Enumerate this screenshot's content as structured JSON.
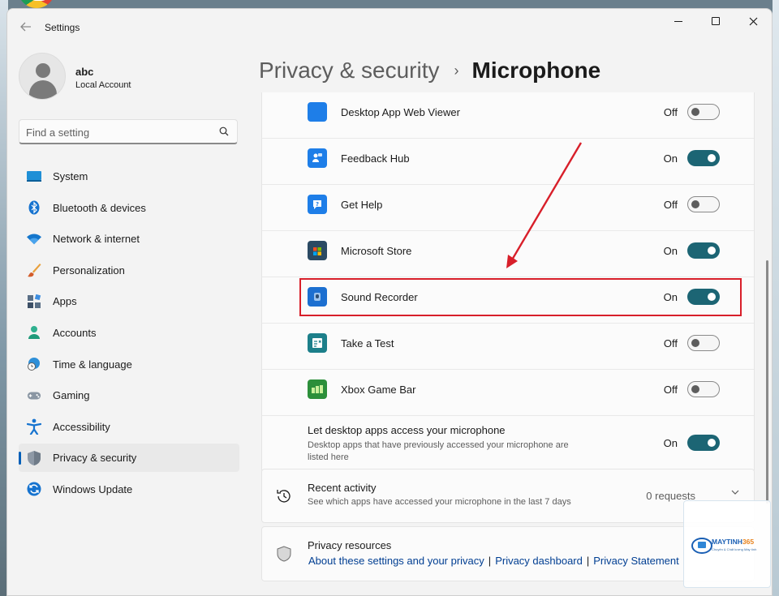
{
  "window": {
    "app_title": "Settings",
    "back_icon": "back-arrow-icon",
    "controls": [
      "minimize-icon",
      "maximize-icon",
      "close-icon"
    ]
  },
  "profile": {
    "name": "abc",
    "account_type": "Local Account"
  },
  "search": {
    "placeholder": "Find a setting"
  },
  "nav": {
    "items": [
      {
        "label": "System",
        "icon": "system-icon"
      },
      {
        "label": "Bluetooth & devices",
        "icon": "bluetooth-icon"
      },
      {
        "label": "Network & internet",
        "icon": "wifi-icon"
      },
      {
        "label": "Personalization",
        "icon": "brush-icon"
      },
      {
        "label": "Apps",
        "icon": "apps-icon"
      },
      {
        "label": "Accounts",
        "icon": "accounts-icon"
      },
      {
        "label": "Time & language",
        "icon": "globe-clock-icon"
      },
      {
        "label": "Gaming",
        "icon": "gamepad-icon"
      },
      {
        "label": "Accessibility",
        "icon": "accessibility-icon"
      },
      {
        "label": "Privacy & security",
        "icon": "shield-icon",
        "active": true
      },
      {
        "label": "Windows Update",
        "icon": "update-icon"
      }
    ]
  },
  "header": {
    "parent": "Privacy & security",
    "separator": "›",
    "current": "Microphone"
  },
  "apps": [
    {
      "name": "Desktop App Web Viewer",
      "state": "Off",
      "icon": "web-viewer-icon",
      "color": "#1e7ee8"
    },
    {
      "name": "Feedback Hub",
      "state": "On",
      "icon": "feedback-hub-icon",
      "color": "#1e7ee8"
    },
    {
      "name": "Get Help",
      "state": "Off",
      "icon": "get-help-icon",
      "color": "#1e7ee8"
    },
    {
      "name": "Microsoft Store",
      "state": "On",
      "icon": "store-icon",
      "color": "#2b4a63"
    },
    {
      "name": "Sound Recorder",
      "state": "On",
      "icon": "sound-recorder-icon",
      "color": "#1c6fd0",
      "highlighted": true
    },
    {
      "name": "Take a Test",
      "state": "Off",
      "icon": "take-a-test-icon",
      "color": "#1c7f8a"
    },
    {
      "name": "Xbox Game Bar",
      "state": "Off",
      "icon": "xbox-game-bar-icon",
      "color": "#2c8f3a"
    }
  ],
  "desktop_access": {
    "title": "Let desktop apps access your microphone",
    "description": "Desktop apps that have previously accessed your microphone are listed here",
    "state": "On"
  },
  "recent_activity": {
    "title": "Recent activity",
    "description": "See which apps have accessed your microphone in the last 7 days",
    "count": "0 requests",
    "icon": "history-icon"
  },
  "privacy_resources": {
    "title": "Privacy resources",
    "links": [
      "About these settings and your privacy",
      "Privacy dashboard",
      "Privacy Statement"
    ],
    "separator": "|",
    "icon": "shield-outline-icon"
  },
  "watermark": {
    "brand": "MAYTINH365",
    "tagline": "Chuyên & Chất lượng Máy tính"
  },
  "colors": {
    "toggle_on": "#1c6574",
    "accent": "#005fb8",
    "highlight_box": "#d81f2a",
    "arrow": "#d81f2a",
    "link": "#003e92"
  }
}
